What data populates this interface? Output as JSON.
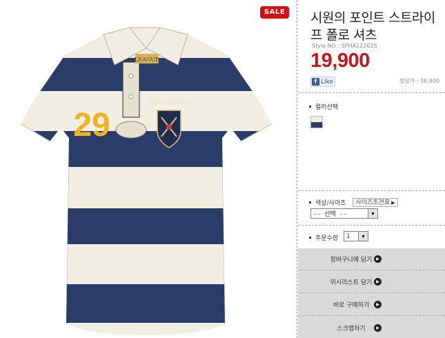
{
  "badge": {
    "sale": "SALE"
  },
  "product": {
    "title": "시원의 포인트 스트라이프 폴로 셔츠",
    "style_no": "Style NO : SPHA122025",
    "price": "19,900",
    "list_price": "정상가 : 38,900",
    "like_label": "Like",
    "fb_glyph": "f",
    "shirt_print": {
      "number": "29",
      "crest_text": "New Haven",
      "label": "LEAGUE"
    }
  },
  "color": {
    "section_label": "컬러선택",
    "swatch_colors": [
      "#f1eee3",
      "#293c6a"
    ]
  },
  "options": {
    "color_size_label": "색상/사이즈",
    "size_chart_button": "사이즈조견표",
    "size_chart_arrow": "▶",
    "select_value": "-- 선택 --",
    "qty_label": "주문수량",
    "qty_value": "1",
    "dropdown_glyph": "▼"
  },
  "actions": [
    {
      "label": "장바구니에 담기",
      "icon": "arrow-circle-icon"
    },
    {
      "label": "위시리스트 담기",
      "icon": "arrow-circle-icon"
    },
    {
      "label": "바로 구매하기",
      "icon": "arrow-circle-icon"
    },
    {
      "label": "스크랩하기",
      "icon": "arrow-circle-icon"
    }
  ],
  "action_glyph": "▶",
  "colors": {
    "accent_red": "#c6161d",
    "navy": "#293c6a",
    "cream": "#f1eee3",
    "action_bg": "#d9d9d9"
  }
}
